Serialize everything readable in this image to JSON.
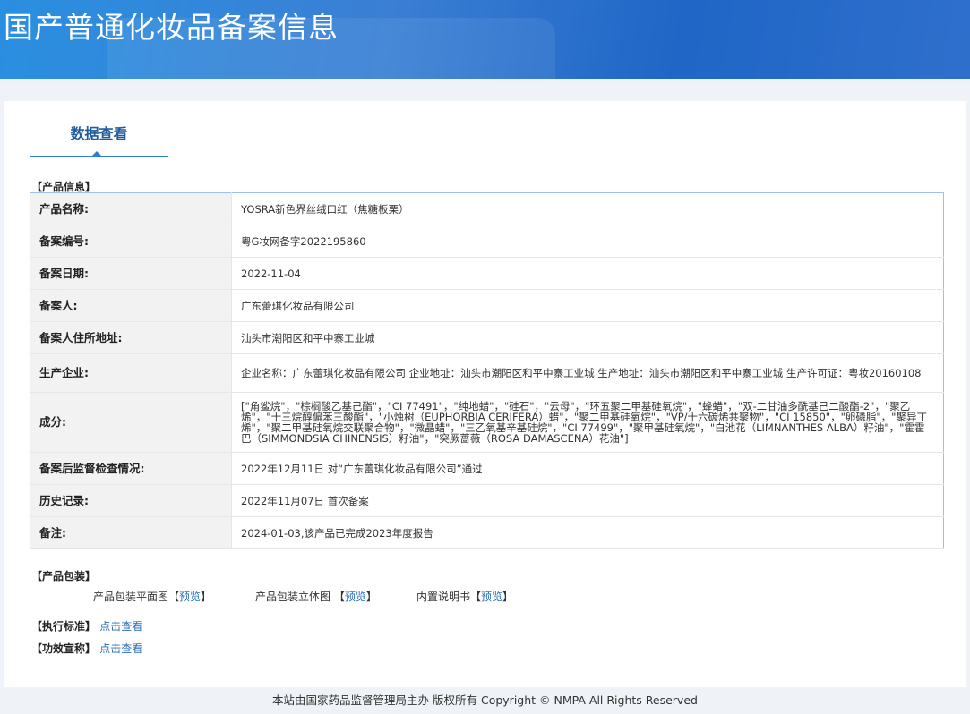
{
  "header": {
    "title": "国产普通化妆品备案信息"
  },
  "tab": {
    "label": "数据查看"
  },
  "product_section": "【产品信息】",
  "rows": [
    {
      "label": "产品名称:",
      "value": "YOSRA新色界丝绒口红（焦糖板栗）"
    },
    {
      "label": "备案编号:",
      "value": "粤G妆网备字2022195860"
    },
    {
      "label": "备案日期:",
      "value": "2022-11-04"
    },
    {
      "label": "备案人:",
      "value": "广东蕾琪化妆品有限公司"
    },
    {
      "label": "备案人住所地址:",
      "value": "汕头市潮阳区和平中寨工业城"
    },
    {
      "label": "生产企业:",
      "value": "企业名称：广东蕾琪化妆品有限公司 企业地址：汕头市潮阳区和平中寨工业城 生产地址：汕头市潮阳区和平中寨工业城 生产许可证：粤妆20160108"
    },
    {
      "label": "成分:",
      "value": "[\"角鲨烷\"，\"棕榈酸乙基己酯\"，\"CI 77491\"，\"纯地蜡\"，\"硅石\"，\"云母\"，\"环五聚二甲基硅氧烷\"，\"蜂蜡\"，\"双-二甘油多酰基己二酸酯-2\"，\"聚乙烯\"，\"十三烷醇偏苯三酸酯\"，\"小烛树（EUPHORBIA CERIFERA）蜡\"，\"聚二甲基硅氧烷\"，\"VP/十六碳烯共聚物\"，\"CI 15850\"，\"卵磷脂\"，\"聚异丁烯\"，\"聚二甲基硅氧烷交联聚合物\"，\"微晶蜡\"，\"三乙氧基辛基硅烷\"，\"CI 77499\"，\"聚甲基硅氧烷\"，\"白池花（LIMNANTHES ALBA）籽油\"，\"霍霍巴（SIMMONDSIA CHINENSIS）籽油\"，\"突厥蔷薇（ROSA DAMASCENA）花油\"]"
    },
    {
      "label": "备案后监督检查情况:",
      "value": "2022年12月11日 对“广东蕾琪化妆品有限公司”通过"
    },
    {
      "label": "历史记录:",
      "value": "2022年11月07日 首次备案"
    },
    {
      "label": "备注:",
      "value": "2024-01-03,该产品已完成2023年度报告"
    }
  ],
  "packaging": {
    "section": "【产品包装】",
    "items": [
      {
        "label": "产品包装平面图",
        "link": "预览"
      },
      {
        "label": "产品包装立体图 ",
        "link": "预览"
      },
      {
        "label": "内置说明书",
        "link": "预览"
      }
    ]
  },
  "standard": {
    "label": "【执行标准】",
    "link": "点击查看"
  },
  "efficacy": {
    "label": "【功效宣称】",
    "link": "点击查看"
  },
  "footer": "本站由国家药品监督管理局主办 版权所有 Copyright © NMPA All Rights Reserved"
}
